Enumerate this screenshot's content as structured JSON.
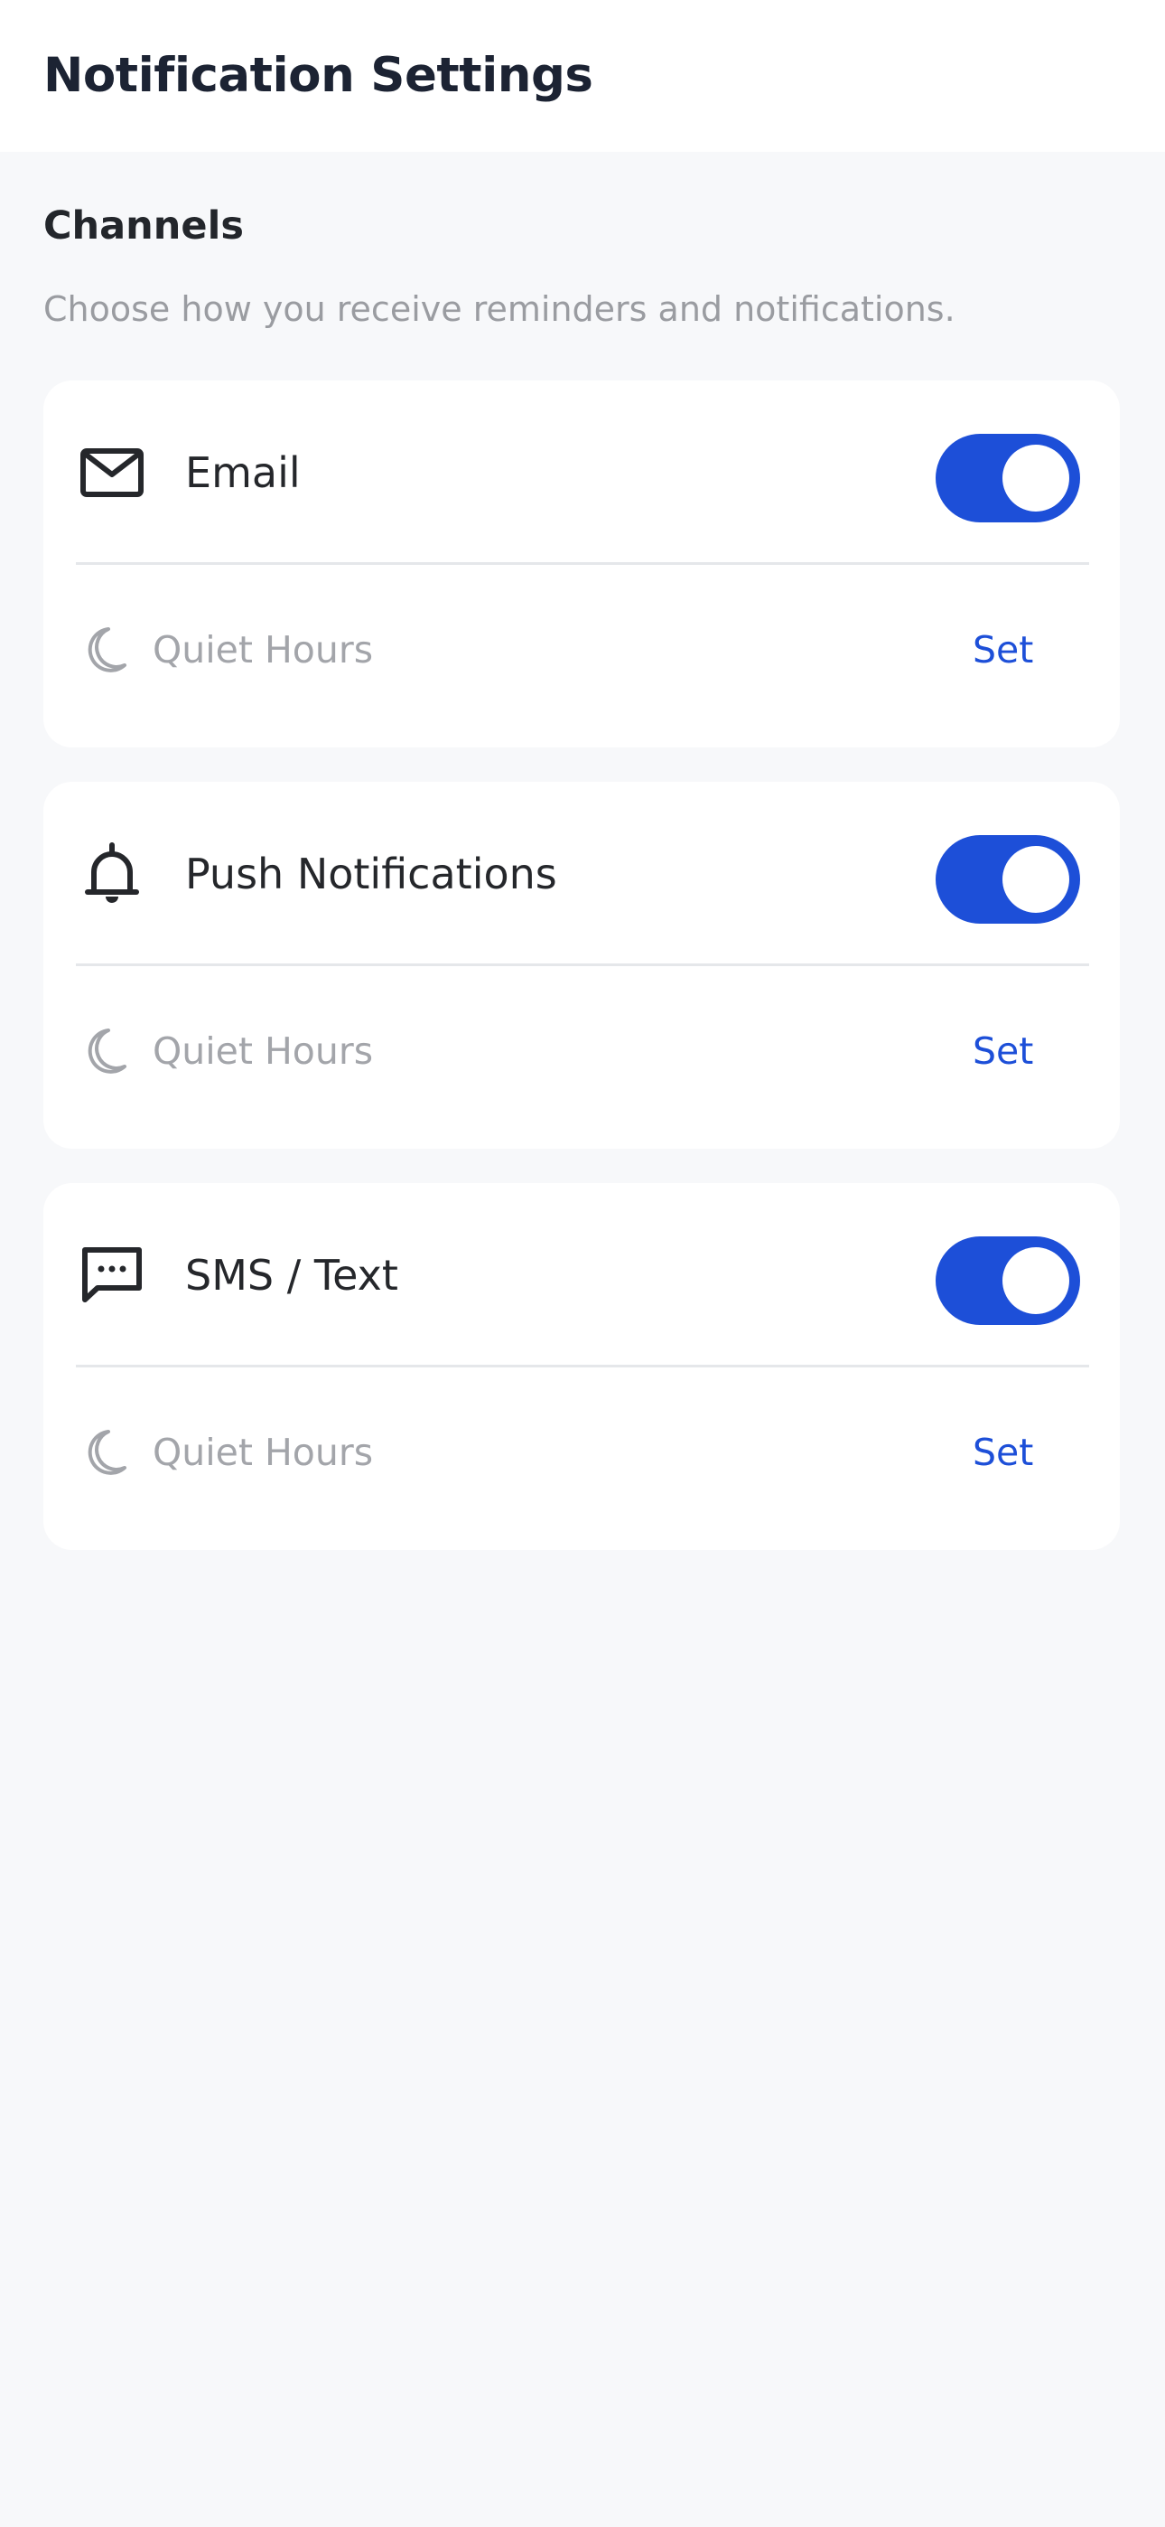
{
  "header": {
    "title": "Notification Settings"
  },
  "section": {
    "title": "Channels",
    "description": "Choose how you receive reminders and notifications."
  },
  "channels": [
    {
      "label": "Email",
      "icon": "mail-icon",
      "enabled": true,
      "quiet_hours_label": "Quiet Hours",
      "quiet_hours_action": "Set"
    },
    {
      "label": "Push Notifications",
      "icon": "bell-icon",
      "enabled": true,
      "quiet_hours_label": "Quiet Hours",
      "quiet_hours_action": "Set"
    },
    {
      "label": "SMS / Text",
      "icon": "message-icon",
      "enabled": true,
      "quiet_hours_label": "Quiet Hours",
      "quiet_hours_action": "Set"
    }
  ],
  "colors": {
    "accent": "#1d4fd8",
    "background": "#f7f8fa",
    "card": "#ffffff",
    "title_text": "#1c2333",
    "muted_text": "#9a9ca1"
  }
}
